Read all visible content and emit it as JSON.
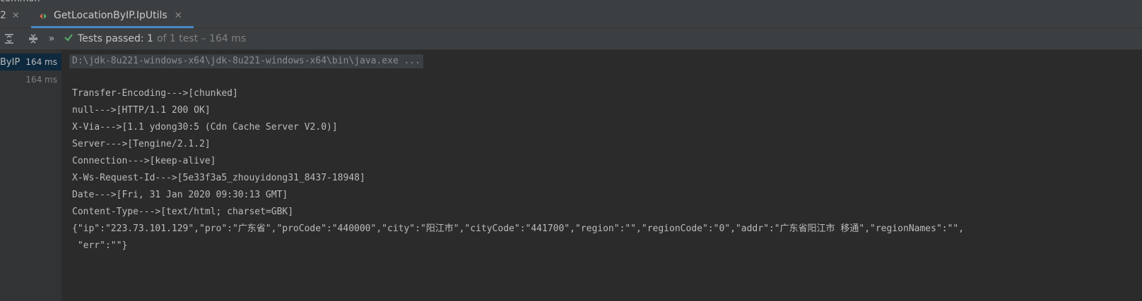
{
  "top_cut_text": "common",
  "tabs": {
    "partial_label": "2",
    "active_label": "GetLocationByIP.IpUtils"
  },
  "toolbar": {
    "status_label": "Tests passed: 1",
    "status_detail": "of 1 test – 164 ms"
  },
  "tree": [
    {
      "name": "ByIP",
      "time": "164 ms",
      "selected": true
    },
    {
      "name": "",
      "time": "164 ms",
      "selected": false
    }
  ],
  "console": {
    "command": "D:\\jdk-8u221-windows-x64\\jdk-8u221-windows-x64\\bin\\java.exe ...",
    "lines": [
      "Transfer-Encoding--->[chunked]",
      "null--->[HTTP/1.1 200 OK]",
      "X-Via--->[1.1 ydong30:5 (Cdn Cache Server V2.0)]",
      "Server--->[Tengine/2.1.2]",
      "Connection--->[keep-alive]",
      "X-Ws-Request-Id--->[5e33f3a5_zhouyidong31_8437-18948]",
      "Date--->[Fri, 31 Jan 2020 09:30:13 GMT]",
      "Content-Type--->[text/html; charset=GBK]",
      "{\"ip\":\"223.73.101.129\",\"pro\":\"广东省\",\"proCode\":\"440000\",\"city\":\"阳江市\",\"cityCode\":\"441700\",\"region\":\"\",\"regionCode\":\"0\",\"addr\":\"广东省阳江市 移通\",\"regionNames\":\"\",",
      " \"err\":\"\"}"
    ]
  },
  "colors": {
    "pass_green": "#59a869",
    "tab_underline": "#4a88c7",
    "selection": "#0d293e"
  }
}
